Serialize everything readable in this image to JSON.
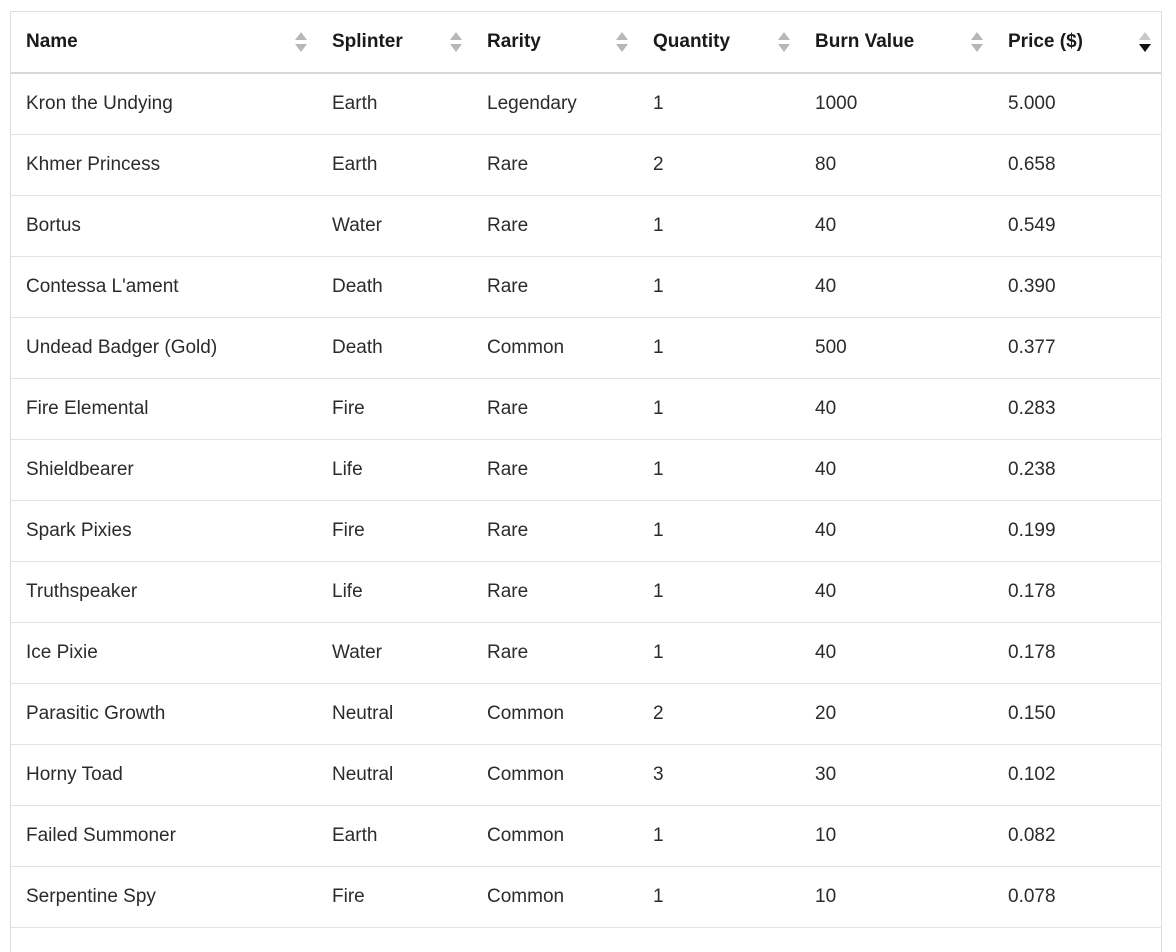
{
  "table": {
    "columns": [
      {
        "label": "Name",
        "sort": "none"
      },
      {
        "label": "Splinter",
        "sort": "none"
      },
      {
        "label": "Rarity",
        "sort": "none"
      },
      {
        "label": "Quantity",
        "sort": "none"
      },
      {
        "label": "Burn Value",
        "sort": "none"
      },
      {
        "label": "Price ($)",
        "sort": "descending"
      }
    ],
    "rows": [
      [
        "Kron the Undying",
        "Earth",
        "Legendary",
        "1",
        "1000",
        "5.000"
      ],
      [
        "Khmer Princess",
        "Earth",
        "Rare",
        "2",
        "80",
        "0.658"
      ],
      [
        "Bortus",
        "Water",
        "Rare",
        "1",
        "40",
        "0.549"
      ],
      [
        "Contessa L'ament",
        "Death",
        "Rare",
        "1",
        "40",
        "0.390"
      ],
      [
        "Undead Badger (Gold)",
        "Death",
        "Common",
        "1",
        "500",
        "0.377"
      ],
      [
        "Fire Elemental",
        "Fire",
        "Rare",
        "1",
        "40",
        "0.283"
      ],
      [
        "Shieldbearer",
        "Life",
        "Rare",
        "1",
        "40",
        "0.238"
      ],
      [
        "Spark Pixies",
        "Fire",
        "Rare",
        "1",
        "40",
        "0.199"
      ],
      [
        "Truthspeaker",
        "Life",
        "Rare",
        "1",
        "40",
        "0.178"
      ],
      [
        "Ice Pixie",
        "Water",
        "Rare",
        "1",
        "40",
        "0.178"
      ],
      [
        "Parasitic Growth",
        "Neutral",
        "Common",
        "2",
        "20",
        "0.150"
      ],
      [
        "Horny Toad",
        "Neutral",
        "Common",
        "3",
        "30",
        "0.102"
      ],
      [
        "Failed Summoner",
        "Earth",
        "Common",
        "1",
        "10",
        "0.082"
      ],
      [
        "Serpentine Spy",
        "Fire",
        "Common",
        "1",
        "10",
        "0.078"
      ]
    ]
  }
}
